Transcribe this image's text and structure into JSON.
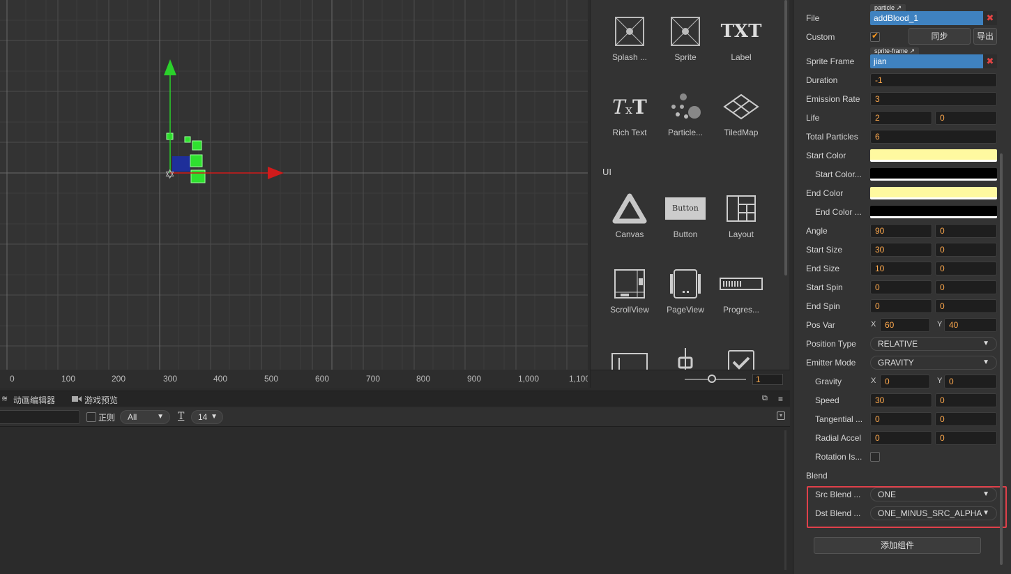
{
  "scene": {
    "ruler_ticks": [
      "0",
      "100",
      "200",
      "300",
      "400",
      "500",
      "600",
      "700",
      "800",
      "900",
      "1,000",
      "1,100"
    ]
  },
  "palette": {
    "items_row1": [
      {
        "label": "Splash ...",
        "icon": "splash-icon"
      },
      {
        "label": "Sprite",
        "icon": "sprite-icon"
      },
      {
        "label": "Label",
        "icon": "label-icon",
        "glyph": "TXT"
      }
    ],
    "items_row2": [
      {
        "label": "Rich Text",
        "icon": "rich-text-icon"
      },
      {
        "label": "Particle...",
        "icon": "particle-icon"
      },
      {
        "label": "TiledMap",
        "icon": "tiledmap-icon"
      }
    ],
    "section_ui": "UI",
    "items_row3": [
      {
        "label": "Canvas",
        "icon": "canvas-icon"
      },
      {
        "label": "Button",
        "icon": "button-icon",
        "glyph": "Button"
      },
      {
        "label": "Layout",
        "icon": "layout-icon"
      }
    ],
    "items_row4": [
      {
        "label": "ScrollView",
        "icon": "scrollview-icon"
      },
      {
        "label": "PageView",
        "icon": "pageview-icon"
      },
      {
        "label": "Progres...",
        "icon": "progressbar-icon"
      }
    ],
    "zoom_value": "1"
  },
  "console": {
    "tab_animation": "动画编辑器",
    "tab_preview": "游戏预览",
    "regex_label": "正则",
    "filter_value": "All",
    "font_size": "14"
  },
  "inspector": {
    "file": {
      "label": "File",
      "tag": "particle",
      "value": "addBlood_1"
    },
    "custom": {
      "label": "Custom",
      "checked": true,
      "sync": "同步",
      "export": "导出"
    },
    "sprite_frame": {
      "label": "Sprite Frame",
      "tag": "sprite-frame",
      "value": "jian"
    },
    "duration": {
      "label": "Duration",
      "value": "-1"
    },
    "emission_rate": {
      "label": "Emission Rate",
      "value": "3"
    },
    "life": {
      "label": "Life",
      "v1": "2",
      "v2": "0"
    },
    "total_particles": {
      "label": "Total Particles",
      "value": "6"
    },
    "start_color": {
      "label": "Start Color",
      "color": "#fff9a0"
    },
    "start_color_var": {
      "label": "Start Color...",
      "color": "#000000"
    },
    "end_color": {
      "label": "End Color",
      "color": "#fff9a0"
    },
    "end_color_var": {
      "label": "End Color ...",
      "color": "#000000"
    },
    "angle": {
      "label": "Angle",
      "v1": "90",
      "v2": "0"
    },
    "start_size": {
      "label": "Start Size",
      "v1": "30",
      "v2": "0"
    },
    "end_size": {
      "label": "End Size",
      "v1": "10",
      "v2": "0"
    },
    "start_spin": {
      "label": "Start Spin",
      "v1": "0",
      "v2": "0"
    },
    "end_spin": {
      "label": "End Spin",
      "v1": "0",
      "v2": "0"
    },
    "pos_var": {
      "label": "Pos Var",
      "x_label": "X",
      "x": "60",
      "y_label": "Y",
      "y": "40"
    },
    "position_type": {
      "label": "Position Type",
      "value": "RELATIVE"
    },
    "emitter_mode": {
      "label": "Emitter Mode",
      "value": "GRAVITY"
    },
    "gravity": {
      "label": "Gravity",
      "x_label": "X",
      "x": "0",
      "y_label": "Y",
      "y": "0"
    },
    "speed": {
      "label": "Speed",
      "v1": "30",
      "v2": "0"
    },
    "tangential": {
      "label": "Tangential ...",
      "v1": "0",
      "v2": "0"
    },
    "radial_accel": {
      "label": "Radial Accel",
      "v1": "0",
      "v2": "0"
    },
    "rotation_is": {
      "label": "Rotation Is...",
      "checked": false
    },
    "blend_label": "Blend",
    "src_blend": {
      "label": "Src Blend ...",
      "value": "ONE"
    },
    "dst_blend": {
      "label": "Dst Blend ...",
      "value": "ONE_MINUS_SRC_ALPHA"
    },
    "add_component": "添加组件"
  },
  "colors": {
    "accent_orange": "#ffa94d",
    "asset_blue": "#3f82c0",
    "highlight_red": "#e0404a",
    "gizmo_green": "#2bd12b",
    "gizmo_red": "#d11b1b"
  }
}
